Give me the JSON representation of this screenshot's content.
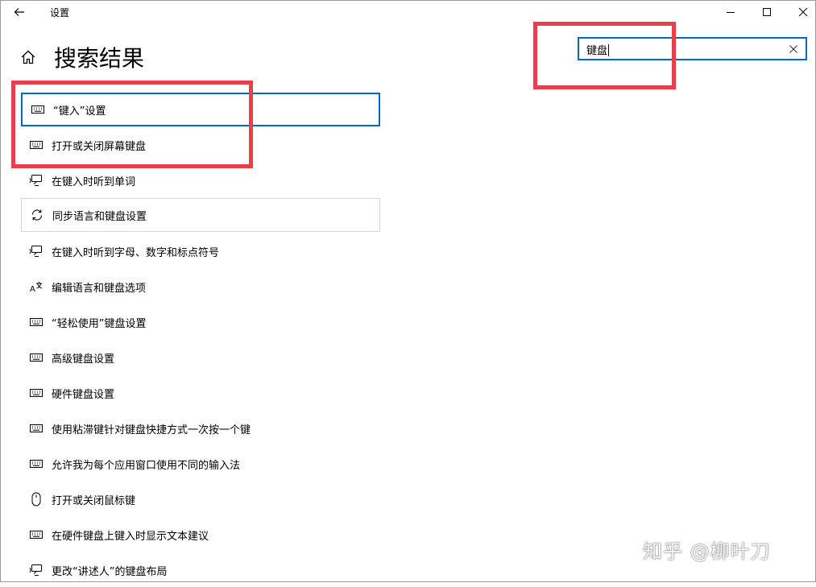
{
  "window": {
    "title": "设置"
  },
  "header": {
    "page_title": "搜索结果"
  },
  "search": {
    "value": "键盘"
  },
  "results": [
    {
      "label": "“键入”设置",
      "icon": "keyboard-icon"
    },
    {
      "label": "打开或关闭屏幕键盘",
      "icon": "keyboard-icon"
    },
    {
      "label": "在键入时听到单词",
      "icon": "narrator-icon"
    },
    {
      "label": "同步语言和键盘设置",
      "icon": "sync-icon"
    },
    {
      "label": "在键入时听到字母、数字和标点符号",
      "icon": "narrator-icon"
    },
    {
      "label": "编辑语言和键盘选项",
      "icon": "language-icon"
    },
    {
      "label": "“轻松使用”键盘设置",
      "icon": "keyboard-icon"
    },
    {
      "label": "高级键盘设置",
      "icon": "keyboard-icon"
    },
    {
      "label": "硬件键盘设置",
      "icon": "keyboard-icon"
    },
    {
      "label": "使用粘滞键针对键盘快捷方式一次按一个键",
      "icon": "keyboard-icon"
    },
    {
      "label": "允许我为每个应用窗口使用不同的输入法",
      "icon": "keyboard-icon"
    },
    {
      "label": "打开或关闭鼠标键",
      "icon": "mouse-icon"
    },
    {
      "label": "在硬件键盘上键入时显示文本建议",
      "icon": "keyboard-icon"
    },
    {
      "label": "更改“讲述人”的键盘布局",
      "icon": "narrator-icon"
    }
  ],
  "watermark": {
    "text": "知乎 @柳叶刀"
  },
  "colors": {
    "accent": "#0067c0",
    "annotation_red": "#e8404a"
  }
}
